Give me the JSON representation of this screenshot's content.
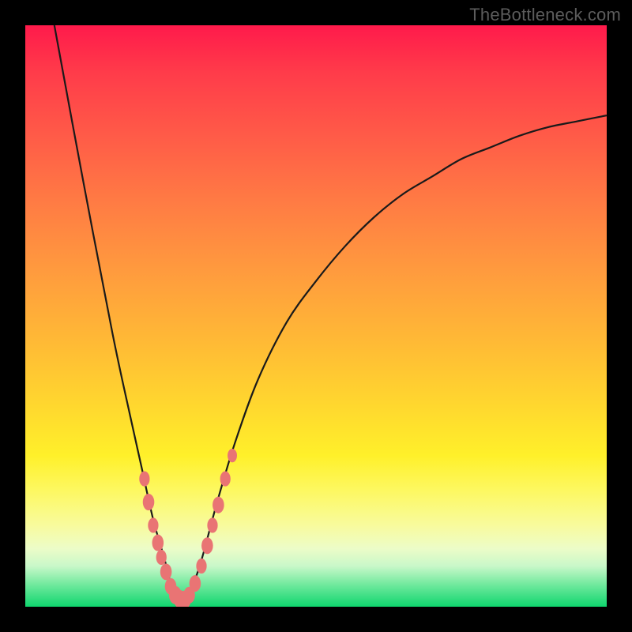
{
  "watermark": "TheBottleneck.com",
  "colors": {
    "marker": "#e97474",
    "curve": "#1a1a1a",
    "frame_bg": "#000000"
  },
  "chart_data": {
    "type": "line",
    "title": "",
    "xlabel": "",
    "ylabel": "",
    "xlim": [
      0,
      100
    ],
    "ylim": [
      0,
      100
    ],
    "grid": false,
    "legend": false,
    "series": [
      {
        "name": "bottleneck-curve",
        "x": [
          5,
          10,
          15,
          18,
          20,
          22,
          24,
          25,
          26,
          27,
          28,
          30,
          33,
          36,
          40,
          45,
          50,
          55,
          60,
          65,
          70,
          75,
          80,
          85,
          90,
          95,
          100
        ],
        "y": [
          100,
          73,
          47,
          33,
          24,
          15,
          8,
          4,
          2,
          1,
          2,
          7,
          18,
          28,
          39,
          49,
          56,
          62,
          67,
          71,
          74,
          77,
          79,
          81,
          82.5,
          83.5,
          84.5
        ]
      }
    ],
    "markers": [
      {
        "x": 20.5,
        "y": 22,
        "r": 1.0
      },
      {
        "x": 21.2,
        "y": 18,
        "r": 1.1
      },
      {
        "x": 22.0,
        "y": 14,
        "r": 1.0
      },
      {
        "x": 22.8,
        "y": 11,
        "r": 1.1
      },
      {
        "x": 23.4,
        "y": 8.5,
        "r": 1.0
      },
      {
        "x": 24.2,
        "y": 6,
        "r": 1.1
      },
      {
        "x": 25.0,
        "y": 3.5,
        "r": 1.1
      },
      {
        "x": 25.8,
        "y": 2,
        "r": 1.2
      },
      {
        "x": 26.6,
        "y": 1.3,
        "r": 1.2
      },
      {
        "x": 27.4,
        "y": 1.2,
        "r": 1.2
      },
      {
        "x": 28.2,
        "y": 2,
        "r": 1.1
      },
      {
        "x": 29.2,
        "y": 4,
        "r": 1.1
      },
      {
        "x": 30.3,
        "y": 7,
        "r": 1.0
      },
      {
        "x": 31.3,
        "y": 10.5,
        "r": 1.1
      },
      {
        "x": 32.2,
        "y": 14,
        "r": 1.0
      },
      {
        "x": 33.2,
        "y": 17.5,
        "r": 1.1
      },
      {
        "x": 34.4,
        "y": 22,
        "r": 1.0
      },
      {
        "x": 35.6,
        "y": 26,
        "r": 0.9
      }
    ]
  }
}
